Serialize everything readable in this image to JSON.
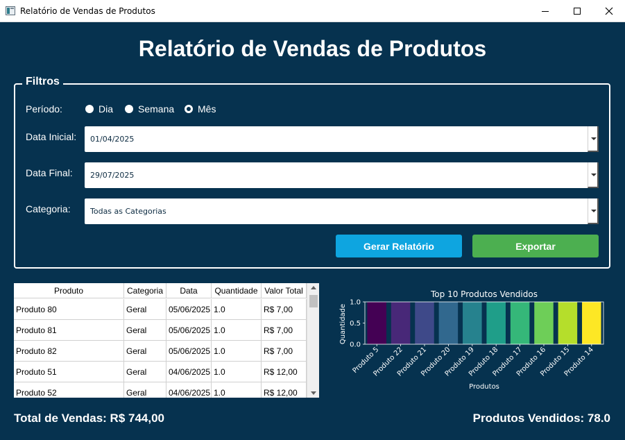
{
  "window": {
    "title": "Relatório de Vendas de Produtos"
  },
  "header": {
    "title": "Relatório de Vendas de Produtos"
  },
  "filters": {
    "legend": "Filtros",
    "period_label": "Período:",
    "period_options": [
      "Dia",
      "Semana",
      "Mês"
    ],
    "period_selected": "Mês",
    "start_label": "Data Inicial:",
    "start_value": "01/04/2025",
    "end_label": "Data Final:",
    "end_value": "29/07/2025",
    "category_label": "Categoria:",
    "category_value": "Todas as Categorias",
    "generate_label": "Gerar Relatório",
    "export_label": "Exportar"
  },
  "colors": {
    "background": "#06324f",
    "generate_button": "#0ea5e0",
    "export_button": "#4caf50"
  },
  "table": {
    "columns": [
      "Produto",
      "Categoria",
      "Data",
      "Quantidade",
      "Valor Total"
    ],
    "rows": [
      [
        "Produto 80",
        "Geral",
        "05/06/2025",
        "1.0",
        "R$ 7,00"
      ],
      [
        "Produto 81",
        "Geral",
        "05/06/2025",
        "1.0",
        "R$ 7,00"
      ],
      [
        "Produto 82",
        "Geral",
        "05/06/2025",
        "1.0",
        "R$ 7,00"
      ],
      [
        "Produto 51",
        "Geral",
        "04/06/2025",
        "1.0",
        "R$ 12,00"
      ],
      [
        "Produto 52",
        "Geral",
        "04/06/2025",
        "1.0",
        "R$ 12,00"
      ]
    ]
  },
  "chart_data": {
    "type": "bar",
    "title": "Top 10 Produtos Vendidos",
    "xlabel": "Produtos",
    "ylabel": "Quantidade",
    "categories": [
      "Produto 5",
      "Produto 22",
      "Produto 21",
      "Produto 20",
      "Produto 19",
      "Produto 18",
      "Produto 17",
      "Produto 16",
      "Produto 15",
      "Produto 14"
    ],
    "values": [
      1.0,
      1.0,
      1.0,
      1.0,
      1.0,
      1.0,
      1.0,
      1.0,
      1.0,
      1.0
    ],
    "ylim": [
      0,
      1.0
    ],
    "yticks": [
      "0.0",
      "0.5",
      "1.0"
    ],
    "colormap": "viridis",
    "bar_colors": [
      "#440154",
      "#482878",
      "#3e4989",
      "#31688e",
      "#26828e",
      "#1f9e89",
      "#35b779",
      "#6ece58",
      "#b5de2b",
      "#fde725"
    ],
    "grid": false
  },
  "footer": {
    "total_sales": "Total de Vendas: R$ 744,00",
    "products_sold": "Produtos Vendidos: 78.0"
  }
}
